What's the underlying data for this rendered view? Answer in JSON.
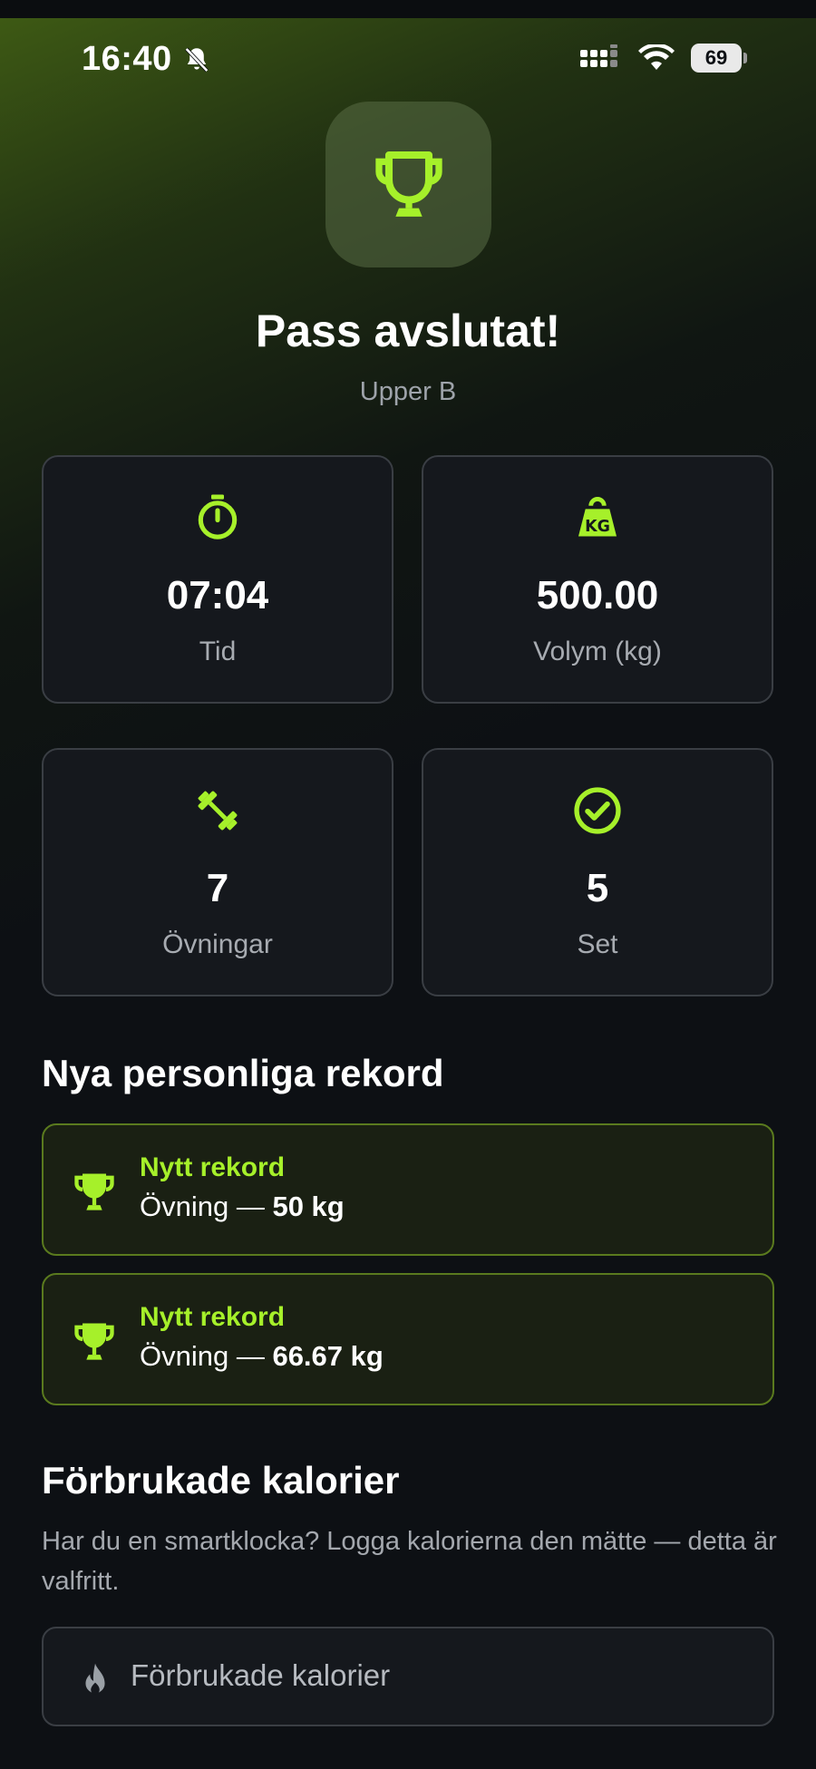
{
  "status_bar": {
    "time": "16:40",
    "battery": "69"
  },
  "header": {
    "title": "Pass avslutat!",
    "subtitle": "Upper B",
    "icon": "trophy-icon"
  },
  "stats": [
    {
      "icon": "stopwatch-icon",
      "value": "07:04",
      "label": "Tid"
    },
    {
      "icon": "kettlebell-kg-icon",
      "value": "500.00",
      "label": "Volym (kg)"
    },
    {
      "icon": "dumbbell-icon",
      "value": "7",
      "label": "Övningar"
    },
    {
      "icon": "check-circle-icon",
      "value": "5",
      "label": "Set"
    }
  ],
  "records": {
    "title": "Nya personliga rekord",
    "items": [
      {
        "title": "Nytt rekord",
        "exercise": "Övning — ",
        "value": "50 kg"
      },
      {
        "title": "Nytt rekord",
        "exercise": "Övning — ",
        "value": "66.67 kg"
      }
    ]
  },
  "calories": {
    "title": "Förbrukade kalorier",
    "description": "Har du en smartklocka? Logga kalorierna den mätte — detta är valfritt.",
    "placeholder": "Förbrukade kalorier"
  },
  "colors": {
    "accent": "#a6f02a",
    "background": "#0d1014",
    "card": "#15181d",
    "card_border": "#3a3e44",
    "record_border": "#5a7a1e"
  }
}
